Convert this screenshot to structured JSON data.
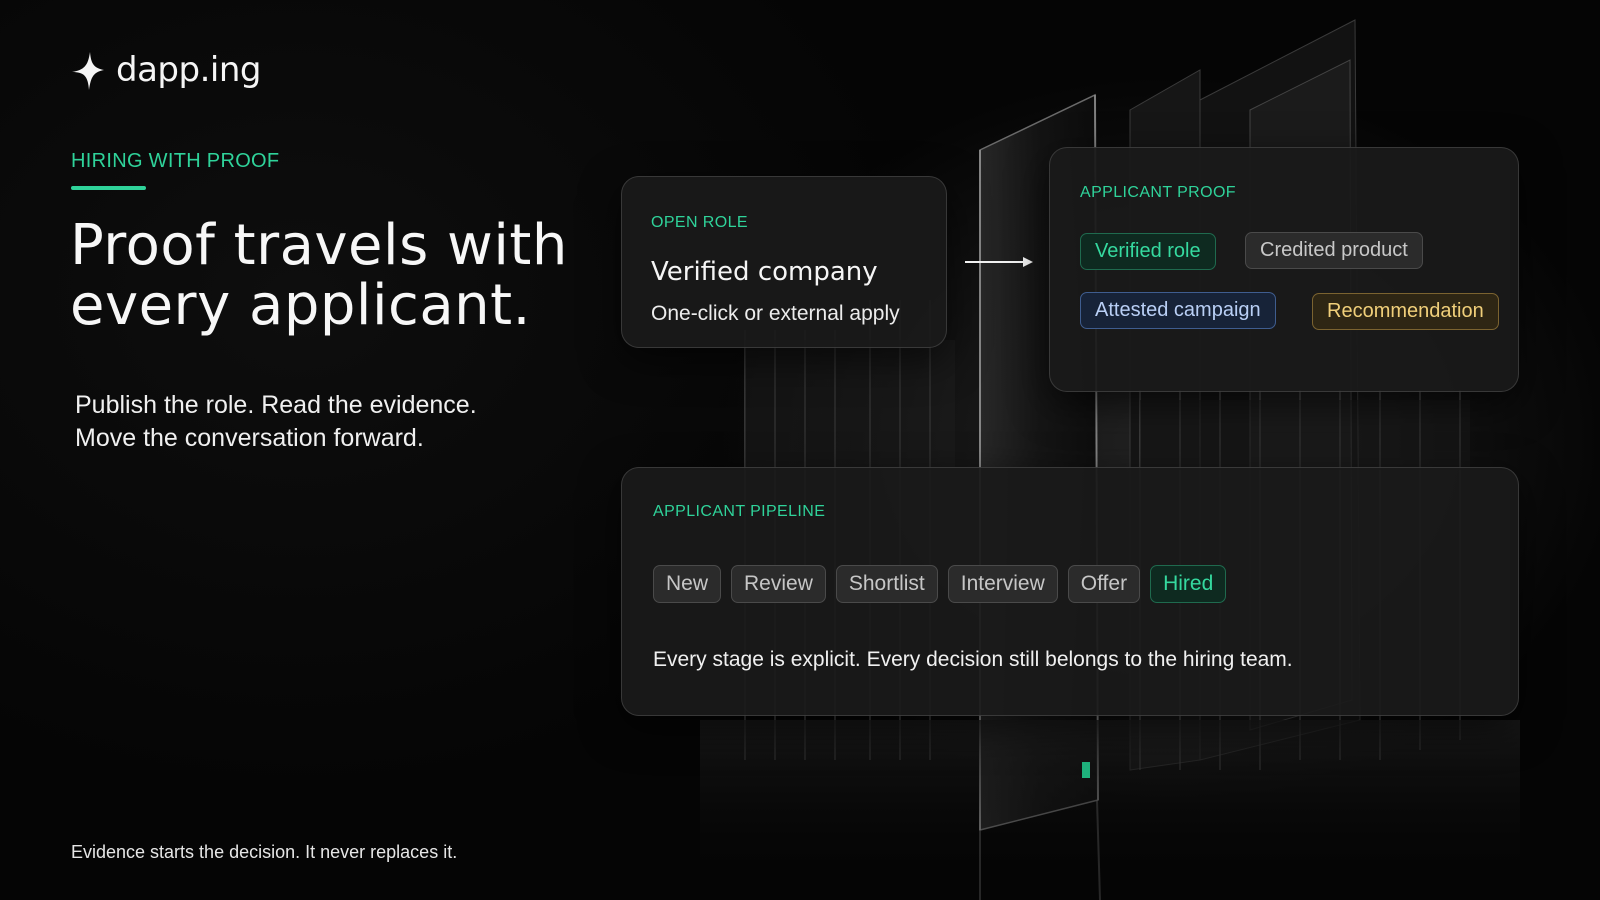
{
  "brand": {
    "logo_text": "dapp.ing",
    "logo_icon": "sparkle-icon"
  },
  "hero": {
    "eyebrow": "HIRING WITH PROOF",
    "headline": "Proof travels with every applicant.",
    "subcopy_line1": "Publish the role. Read the evidence.",
    "subcopy_line2": "Move the conversation forward."
  },
  "role_card": {
    "label": "OPEN ROLE",
    "title": "Verified company",
    "subtitle": "One-click or external apply"
  },
  "proof_card": {
    "label": "APPLICANT PROOF",
    "chips": [
      {
        "label": "Verified role",
        "color": "#35d99f"
      },
      {
        "label": "Credited product",
        "color": "#c8c8c8"
      },
      {
        "label": "Attested campaign",
        "color": "#b9cff5"
      },
      {
        "label": "Recommendation",
        "color": "#f0cf7a"
      }
    ]
  },
  "pipeline_card": {
    "label": "APPLICANT PIPELINE",
    "stages": [
      {
        "label": "New",
        "active": false
      },
      {
        "label": "Review",
        "active": false
      },
      {
        "label": "Shortlist",
        "active": false
      },
      {
        "label": "Interview",
        "active": false
      },
      {
        "label": "Offer",
        "active": false
      },
      {
        "label": "Hired",
        "active": true
      }
    ],
    "note": "Every stage is explicit. Every decision still belongs to the hiring team."
  },
  "footer": {
    "note": "Evidence starts the decision. It never replaces it."
  },
  "colors": {
    "accent": "#2fd39a",
    "background": "#050505",
    "card": "#1a1a1a"
  }
}
